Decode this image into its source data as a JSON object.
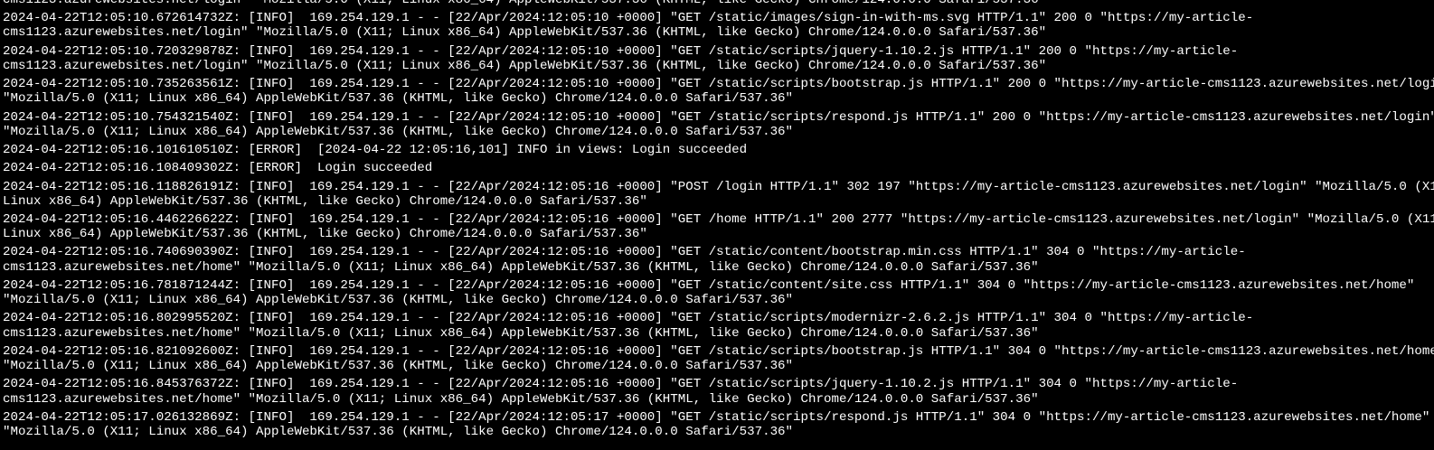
{
  "terminal": {
    "entries": [
      [
        "cms1123.azurewebsites.net/login\" \"Mozilla/5.0 (X11; Linux x86_64) AppleWebKit/537.36 (KHTML, like Gecko) Chrome/124.0.0.0 Safari/537.36\""
      ],
      [
        "2024-04-22T12:05:10.672614732Z: [INFO]  169.254.129.1 - - [22/Apr/2024:12:05:10 +0000] \"GET /static/images/sign-in-with-ms.svg HTTP/1.1\" 200 0 \"https://my-article-",
        "cms1123.azurewebsites.net/login\" \"Mozilla/5.0 (X11; Linux x86_64) AppleWebKit/537.36 (KHTML, like Gecko) Chrome/124.0.0.0 Safari/537.36\""
      ],
      [
        "2024-04-22T12:05:10.720329878Z: [INFO]  169.254.129.1 - - [22/Apr/2024:12:05:10 +0000] \"GET /static/scripts/jquery-1.10.2.js HTTP/1.1\" 200 0 \"https://my-article-",
        "cms1123.azurewebsites.net/login\" \"Mozilla/5.0 (X11; Linux x86_64) AppleWebKit/537.36 (KHTML, like Gecko) Chrome/124.0.0.0 Safari/537.36\""
      ],
      [
        "2024-04-22T12:05:10.735263561Z: [INFO]  169.254.129.1 - - [22/Apr/2024:12:05:10 +0000] \"GET /static/scripts/bootstrap.js HTTP/1.1\" 200 0 \"https://my-article-cms1123.azurewebsites.net/login\"",
        "\"Mozilla/5.0 (X11; Linux x86_64) AppleWebKit/537.36 (KHTML, like Gecko) Chrome/124.0.0.0 Safari/537.36\""
      ],
      [
        "2024-04-22T12:05:10.754321540Z: [INFO]  169.254.129.1 - - [22/Apr/2024:12:05:10 +0000] \"GET /static/scripts/respond.js HTTP/1.1\" 200 0 \"https://my-article-cms1123.azurewebsites.net/login\"",
        "\"Mozilla/5.0 (X11; Linux x86_64) AppleWebKit/537.36 (KHTML, like Gecko) Chrome/124.0.0.0 Safari/537.36\""
      ],
      [
        "2024-04-22T12:05:16.101610510Z: [ERROR]  [2024-04-22 12:05:16,101] INFO in views: Login succeeded"
      ],
      [
        "2024-04-22T12:05:16.108409302Z: [ERROR]  Login succeeded"
      ],
      [
        "2024-04-22T12:05:16.118826191Z: [INFO]  169.254.129.1 - - [22/Apr/2024:12:05:16 +0000] \"POST /login HTTP/1.1\" 302 197 \"https://my-article-cms1123.azurewebsites.net/login\" \"Mozilla/5.0 (X11;",
        "Linux x86_64) AppleWebKit/537.36 (KHTML, like Gecko) Chrome/124.0.0.0 Safari/537.36\""
      ],
      [
        "2024-04-22T12:05:16.446226622Z: [INFO]  169.254.129.1 - - [22/Apr/2024:12:05:16 +0000] \"GET /home HTTP/1.1\" 200 2777 \"https://my-article-cms1123.azurewebsites.net/login\" \"Mozilla/5.0 (X11;",
        "Linux x86_64) AppleWebKit/537.36 (KHTML, like Gecko) Chrome/124.0.0.0 Safari/537.36\""
      ],
      [
        "2024-04-22T12:05:16.740690390Z: [INFO]  169.254.129.1 - - [22/Apr/2024:12:05:16 +0000] \"GET /static/content/bootstrap.min.css HTTP/1.1\" 304 0 \"https://my-article-",
        "cms1123.azurewebsites.net/home\" \"Mozilla/5.0 (X11; Linux x86_64) AppleWebKit/537.36 (KHTML, like Gecko) Chrome/124.0.0.0 Safari/537.36\""
      ],
      [
        "2024-04-22T12:05:16.781871244Z: [INFO]  169.254.129.1 - - [22/Apr/2024:12:05:16 +0000] \"GET /static/content/site.css HTTP/1.1\" 304 0 \"https://my-article-cms1123.azurewebsites.net/home\"",
        "\"Mozilla/5.0 (X11; Linux x86_64) AppleWebKit/537.36 (KHTML, like Gecko) Chrome/124.0.0.0 Safari/537.36\""
      ],
      [
        "2024-04-22T12:05:16.802995520Z: [INFO]  169.254.129.1 - - [22/Apr/2024:12:05:16 +0000] \"GET /static/scripts/modernizr-2.6.2.js HTTP/1.1\" 304 0 \"https://my-article-",
        "cms1123.azurewebsites.net/home\" \"Mozilla/5.0 (X11; Linux x86_64) AppleWebKit/537.36 (KHTML, like Gecko) Chrome/124.0.0.0 Safari/537.36\""
      ],
      [
        "2024-04-22T12:05:16.821092600Z: [INFO]  169.254.129.1 - - [22/Apr/2024:12:05:16 +0000] \"GET /static/scripts/bootstrap.js HTTP/1.1\" 304 0 \"https://my-article-cms1123.azurewebsites.net/home\"",
        "\"Mozilla/5.0 (X11; Linux x86_64) AppleWebKit/537.36 (KHTML, like Gecko) Chrome/124.0.0.0 Safari/537.36\""
      ],
      [
        "2024-04-22T12:05:16.845376372Z: [INFO]  169.254.129.1 - - [22/Apr/2024:12:05:16 +0000] \"GET /static/scripts/jquery-1.10.2.js HTTP/1.1\" 304 0 \"https://my-article-",
        "cms1123.azurewebsites.net/home\" \"Mozilla/5.0 (X11; Linux x86_64) AppleWebKit/537.36 (KHTML, like Gecko) Chrome/124.0.0.0 Safari/537.36\""
      ],
      [
        "2024-04-22T12:05:17.026132869Z: [INFO]  169.254.129.1 - - [22/Apr/2024:12:05:17 +0000] \"GET /static/scripts/respond.js HTTP/1.1\" 304 0 \"https://my-article-cms1123.azurewebsites.net/home\"",
        "\"Mozilla/5.0 (X11; Linux x86_64) AppleWebKit/537.36 (KHTML, like Gecko) Chrome/124.0.0.0 Safari/537.36\""
      ]
    ],
    "colors": {
      "background": "#000000",
      "foreground": "#ffffff"
    }
  }
}
